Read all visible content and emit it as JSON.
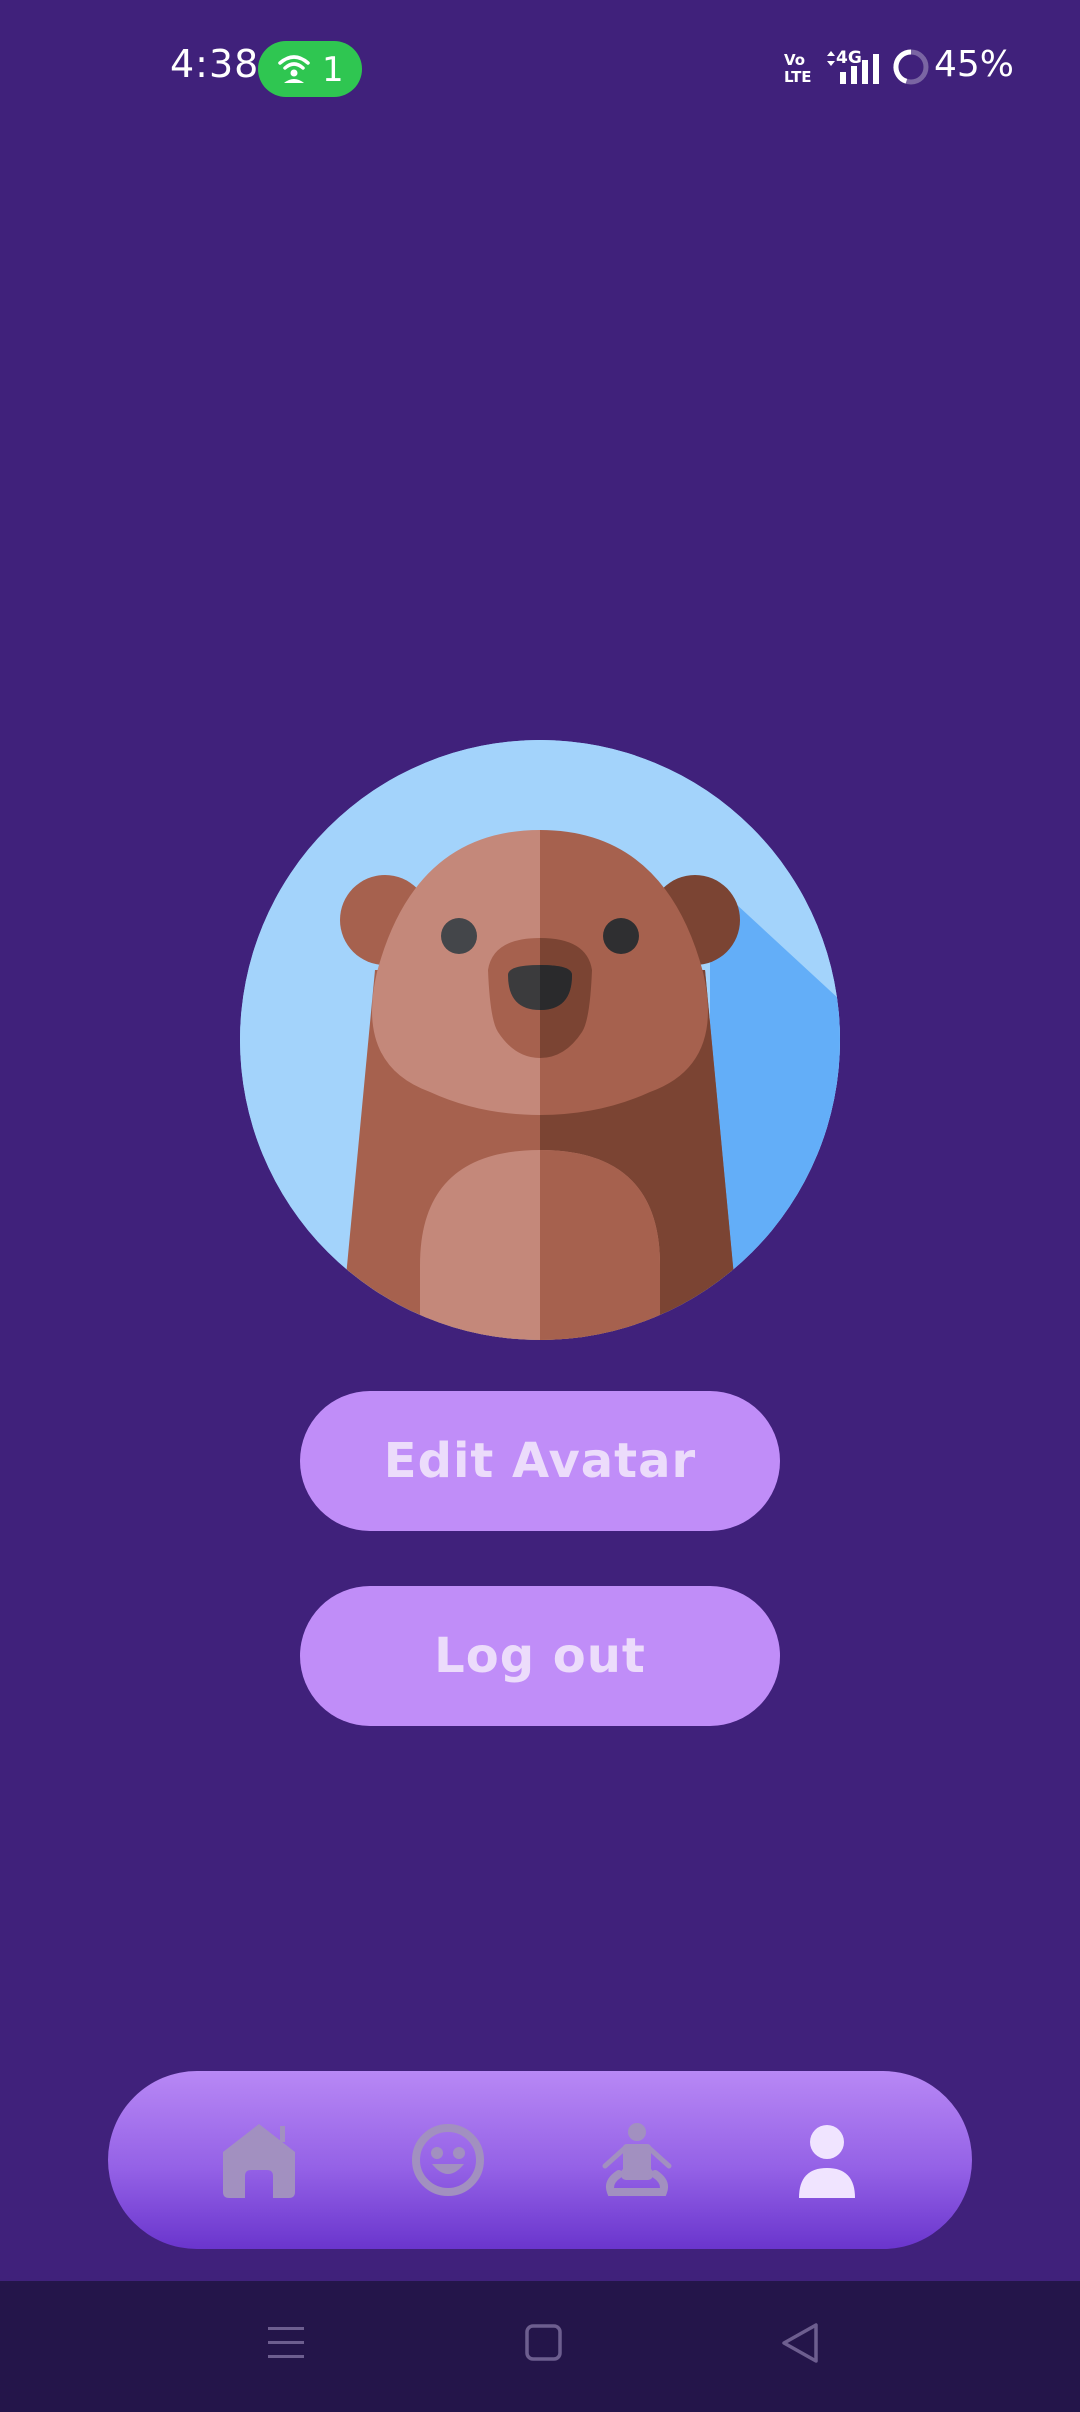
{
  "status_bar": {
    "time": "4:38",
    "hotspot_count": "1",
    "volte": "Vo\nLTE",
    "network": "4G",
    "battery": "45%"
  },
  "profile": {
    "avatar": "bear-avatar",
    "edit_avatar_label": "Edit Avatar",
    "logout_label": "Log out"
  },
  "bottom_nav": {
    "items": [
      {
        "icon": "home-icon",
        "active": false
      },
      {
        "icon": "smiley-icon",
        "active": false
      },
      {
        "icon": "meditation-icon",
        "active": false
      },
      {
        "icon": "profile-icon",
        "active": true
      }
    ]
  },
  "system_nav": {
    "items": [
      "menu-icon",
      "home-square-icon",
      "back-triangle-icon"
    ]
  },
  "colors": {
    "background": "#40217b",
    "button": "#c08df8",
    "button_text": "#ecdcfb",
    "nav_inactive": "#a290c0",
    "nav_active": "#f0e4ff",
    "hotspot_green": "#2fc651"
  }
}
